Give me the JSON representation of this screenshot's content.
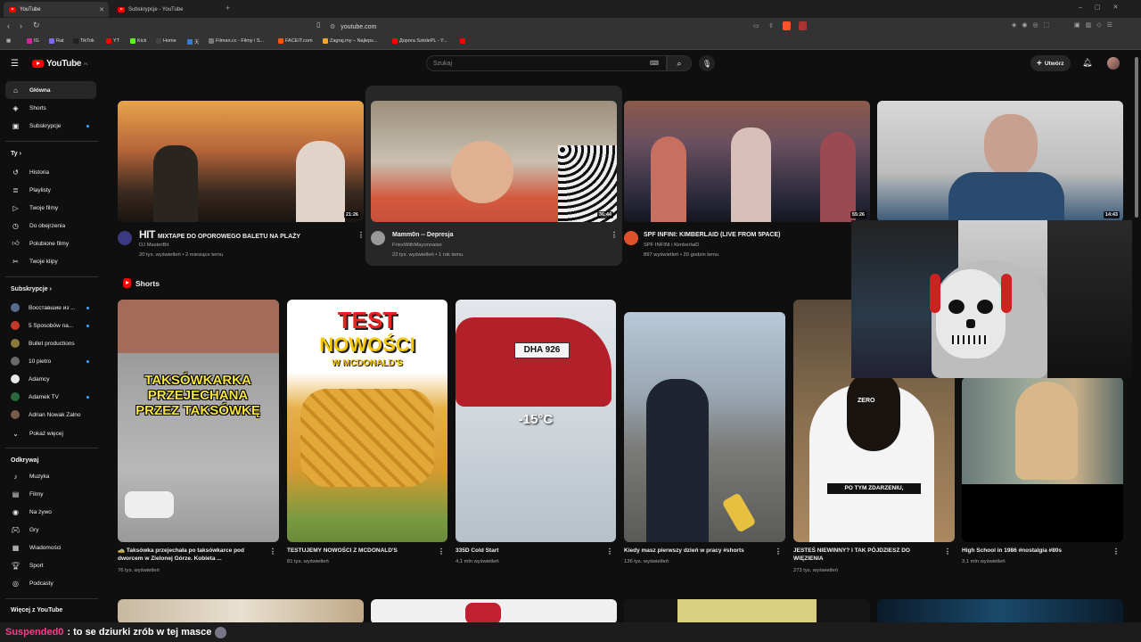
{
  "browser": {
    "tabs": [
      {
        "label": "YouTube",
        "active": true
      },
      {
        "label": "Subskrypcje - YouTube",
        "active": false
      }
    ],
    "url": "youtube.com",
    "bookmarks": [
      {
        "label": "IG",
        "color": "#d6249f"
      },
      {
        "label": "Rat",
        "color": "#7b68ee"
      },
      {
        "label": "TikTok",
        "color": "#222222"
      },
      {
        "label": "YT",
        "color": "#ff0000"
      },
      {
        "label": "Kick",
        "color": "#53fc18"
      },
      {
        "label": "Home",
        "color": "#444444"
      },
      {
        "label": "天",
        "color": "#3a7bd5"
      },
      {
        "label": "Filman.cc - Filmy i S...",
        "color": "#777777"
      },
      {
        "label": "FACEIT.com",
        "color": "#ff5500"
      },
      {
        "label": "Zagraj.my – Najleps...",
        "color": "#f5a623"
      },
      {
        "label": "Дорога SztolePL - Y...",
        "color": "#ff0000"
      },
      {
        "label": "",
        "color": "#ff0000"
      }
    ]
  },
  "header": {
    "logo": "YouTube",
    "logo_region": "PL",
    "search_placeholder": "Szukaj",
    "create_label": "Utwórz"
  },
  "sidebar": {
    "main": [
      {
        "label": "Główna",
        "icon": "home-icon",
        "active": true
      },
      {
        "label": "Shorts",
        "icon": "shorts-icon"
      },
      {
        "label": "Subskrypcje",
        "icon": "subscriptions-icon",
        "dot": true
      }
    ],
    "you_header": "Ty",
    "you": [
      {
        "label": "Historia",
        "icon": "history-icon"
      },
      {
        "label": "Playlisty",
        "icon": "playlist-icon"
      },
      {
        "label": "Twoje filmy",
        "icon": "your-videos-icon"
      },
      {
        "label": "Do obejrzenia",
        "icon": "watch-later-icon"
      },
      {
        "label": "Polubione filmy",
        "icon": "liked-icon"
      },
      {
        "label": "Twoje klipy",
        "icon": "clips-icon"
      }
    ],
    "subs_header": "Subskrypcje",
    "subs": [
      {
        "label": "Восставшие из ...",
        "color": "#5a6a8a",
        "dot": true
      },
      {
        "label": "5 Sposobów na...",
        "color": "#c23a2a",
        "dot": true
      },
      {
        "label": "Bullet productions",
        "color": "#8a7a3a"
      },
      {
        "label": "10 pietro",
        "color": "#6a6a6a",
        "dot": true
      },
      {
        "label": "Adamcy",
        "color": "#e8e8e8"
      },
      {
        "label": "Adamek TV",
        "color": "#2a6a3a",
        "dot": true
      },
      {
        "label": "Adrian Nowak Zalno",
        "color": "#7a5a4a"
      }
    ],
    "show_more": "Pokaż więcej",
    "explore_header": "Odkrywaj",
    "explore": [
      {
        "label": "Muzyka",
        "icon": "music-icon"
      },
      {
        "label": "Filmy",
        "icon": "movies-icon"
      },
      {
        "label": "Na żywo",
        "icon": "live-icon"
      },
      {
        "label": "Gry",
        "icon": "gaming-icon"
      },
      {
        "label": "Wiadomości",
        "icon": "news-icon"
      },
      {
        "label": "Sport",
        "icon": "sport-icon"
      },
      {
        "label": "Podcasty",
        "icon": "podcast-icon"
      }
    ],
    "more_header": "Więcej z YouTube"
  },
  "videos": [
    {
      "title": "MIXTAPE DO OPOROWEGO BALETU NA PLAŻY",
      "channel": "DJ MasterBit",
      "meta": "20 tys. wyświetleń • 2 miesiące temu",
      "duration": "21:26",
      "prefix": "HIT"
    },
    {
      "title": "Mamm0n -- Depresja",
      "channel": "FriesWithMayonnaise",
      "meta": "22 tys. wyświetleń • 1 rok temu",
      "duration": "36:44"
    },
    {
      "title": "SPF INFINI: KIMBERLAID (LIVE FROM 5PACE)",
      "channel": "SPF INFINI i KimberlaiD",
      "meta": "897 wyświetleń • 20 godzin temu",
      "duration": "55:26"
    },
    {
      "title": "",
      "channel": "",
      "meta": "",
      "duration": "14:43"
    }
  ],
  "shorts_header": "Shorts",
  "shorts": [
    {
      "title": "🚕 Taksówka przejechała po taksówkarce pod dworcem w Zielonej Górze. Kobieta ...",
      "views": "76 tys. wyświetleń",
      "overlay": "TAKSÓWKARKA PRZEJECHANA PRZEZ TAKSÓWKĘ"
    },
    {
      "title": "TESTUJEMY NOWOŚCI Z MCDONALD'S",
      "views": "81 tys. wyświetleń",
      "overlay_a": "TEST",
      "overlay_b": "NOWOŚCI",
      "overlay_c": "W MCDONALD'S"
    },
    {
      "title": "335D Cold Start",
      "views": "4,1 mln wyświetleń",
      "overlay": "-15°C",
      "plate": "DHA 926"
    },
    {
      "title": "Kiedy masz pierwszy dzień w pracy #shorts",
      "views": "136 tys. wyświetleń"
    },
    {
      "title": "JESTEŚ NIEWINNY? I TAK PÓJDZIESZ DO WIĘZIENIA",
      "views": "273 tys. wyświetleń",
      "overlay": "PO TYM ZDARZENIU,",
      "logo": "ZERO"
    },
    {
      "title": "High School in 1986 #nostalgia #80s",
      "views": "3,1 mln wyświetleń"
    }
  ],
  "chat": {
    "user": "Suspended0",
    "message": ": to se dziurki zrób w tej masce"
  }
}
